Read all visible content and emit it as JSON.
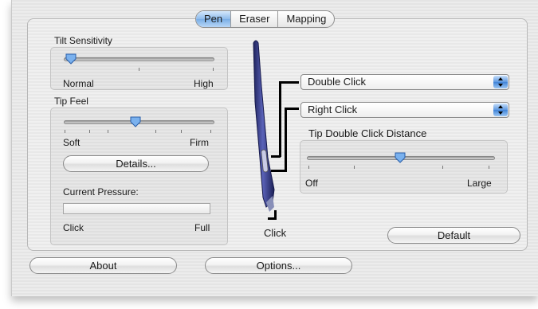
{
  "tabs": [
    {
      "label": "Pen",
      "active": true
    },
    {
      "label": "Eraser",
      "active": false
    },
    {
      "label": "Mapping",
      "active": false
    }
  ],
  "tilt": {
    "title": "Tilt Sensitivity",
    "min_label": "Normal",
    "max_label": "High",
    "level": 0.0
  },
  "tip_feel": {
    "title": "Tip Feel",
    "min_label": "Soft",
    "max_label": "Firm",
    "level": 0.5
  },
  "details_button": "Details...",
  "pressure": {
    "label": "Current Pressure:",
    "min_label": "Click",
    "max_label": "Full",
    "level": 0.0
  },
  "side_switch_upper": "Double Click",
  "side_switch_lower": "Right Click",
  "double_click_distance": {
    "title": "Tip Double Click Distance",
    "min_label": "Off",
    "max_label": "Large",
    "level": 0.5
  },
  "tip_label": "Click",
  "default_button": "Default",
  "about_button": "About",
  "options_button": "Options...",
  "colors": {
    "accent": "#7aaee6",
    "pen_body": "#3a3f8c",
    "popup_arrows": "#3f83d8"
  }
}
